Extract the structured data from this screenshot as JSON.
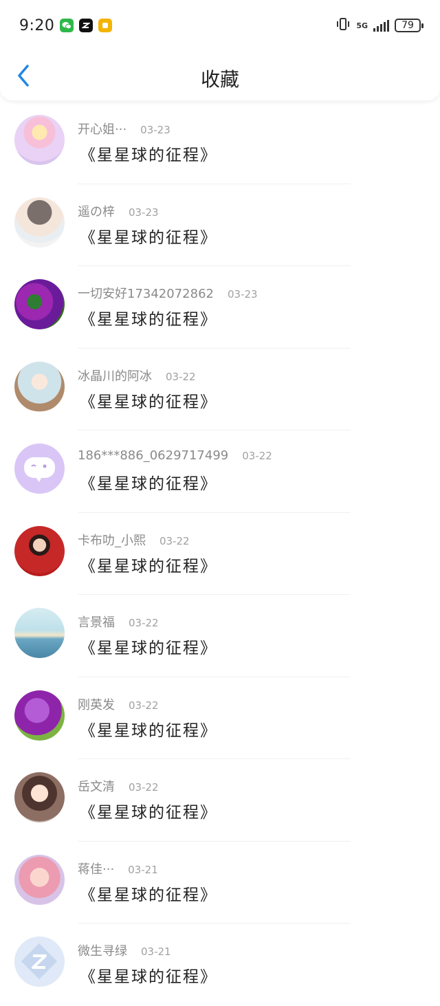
{
  "status_bar": {
    "time": "9:20",
    "network": "5G",
    "battery": "79",
    "app_icons": [
      "wechat-icon",
      "capcut-icon",
      "notes-icon"
    ]
  },
  "header": {
    "title": "收藏",
    "back_icon": "chevron-left-icon"
  },
  "colors": {
    "accent": "#1e88e5",
    "name_gray": "#8a8a8a",
    "divider": "#f0f0f0"
  },
  "favorites": [
    {
      "name": "开心姐···",
      "date": "03-23",
      "work": "《星星球的征程》",
      "avatar": "anime-girl-pink"
    },
    {
      "name": "遥の梓",
      "date": "03-23",
      "work": "《星星球的征程》",
      "avatar": "anime-boy-cap"
    },
    {
      "name": "一切安好17342072862",
      "date": "03-23",
      "work": "《星星球的征程》",
      "avatar": "purple-flowers"
    },
    {
      "name": "冰晶川的阿冰",
      "date": "03-22",
      "work": "《星星球的征程》",
      "avatar": "anime-blue-hair"
    },
    {
      "name": "186***886_0629717499",
      "date": "03-22",
      "work": "《星星球的征程》",
      "avatar": "default-chat-purple"
    },
    {
      "name": "卡布叻_小熙",
      "date": "03-22",
      "work": "《星星球的征程》",
      "avatar": "red-dress-child"
    },
    {
      "name": "言景福",
      "date": "03-22",
      "work": "《星星球的征程》",
      "avatar": "sea-landscape"
    },
    {
      "name": "刚英发",
      "date": "03-22",
      "work": "《星星球的征程》",
      "avatar": "purple-tulips"
    },
    {
      "name": "岳文清",
      "date": "03-22",
      "work": "《星星球的征程》",
      "avatar": "cartoon-girl-drink"
    },
    {
      "name": "蒋佳···",
      "date": "03-21",
      "work": "《星星球的征程》",
      "avatar": "baby-pink"
    },
    {
      "name": "微生寻绿",
      "date": "03-21",
      "work": "《星星球的征程》",
      "avatar": "default-z-blue"
    }
  ]
}
